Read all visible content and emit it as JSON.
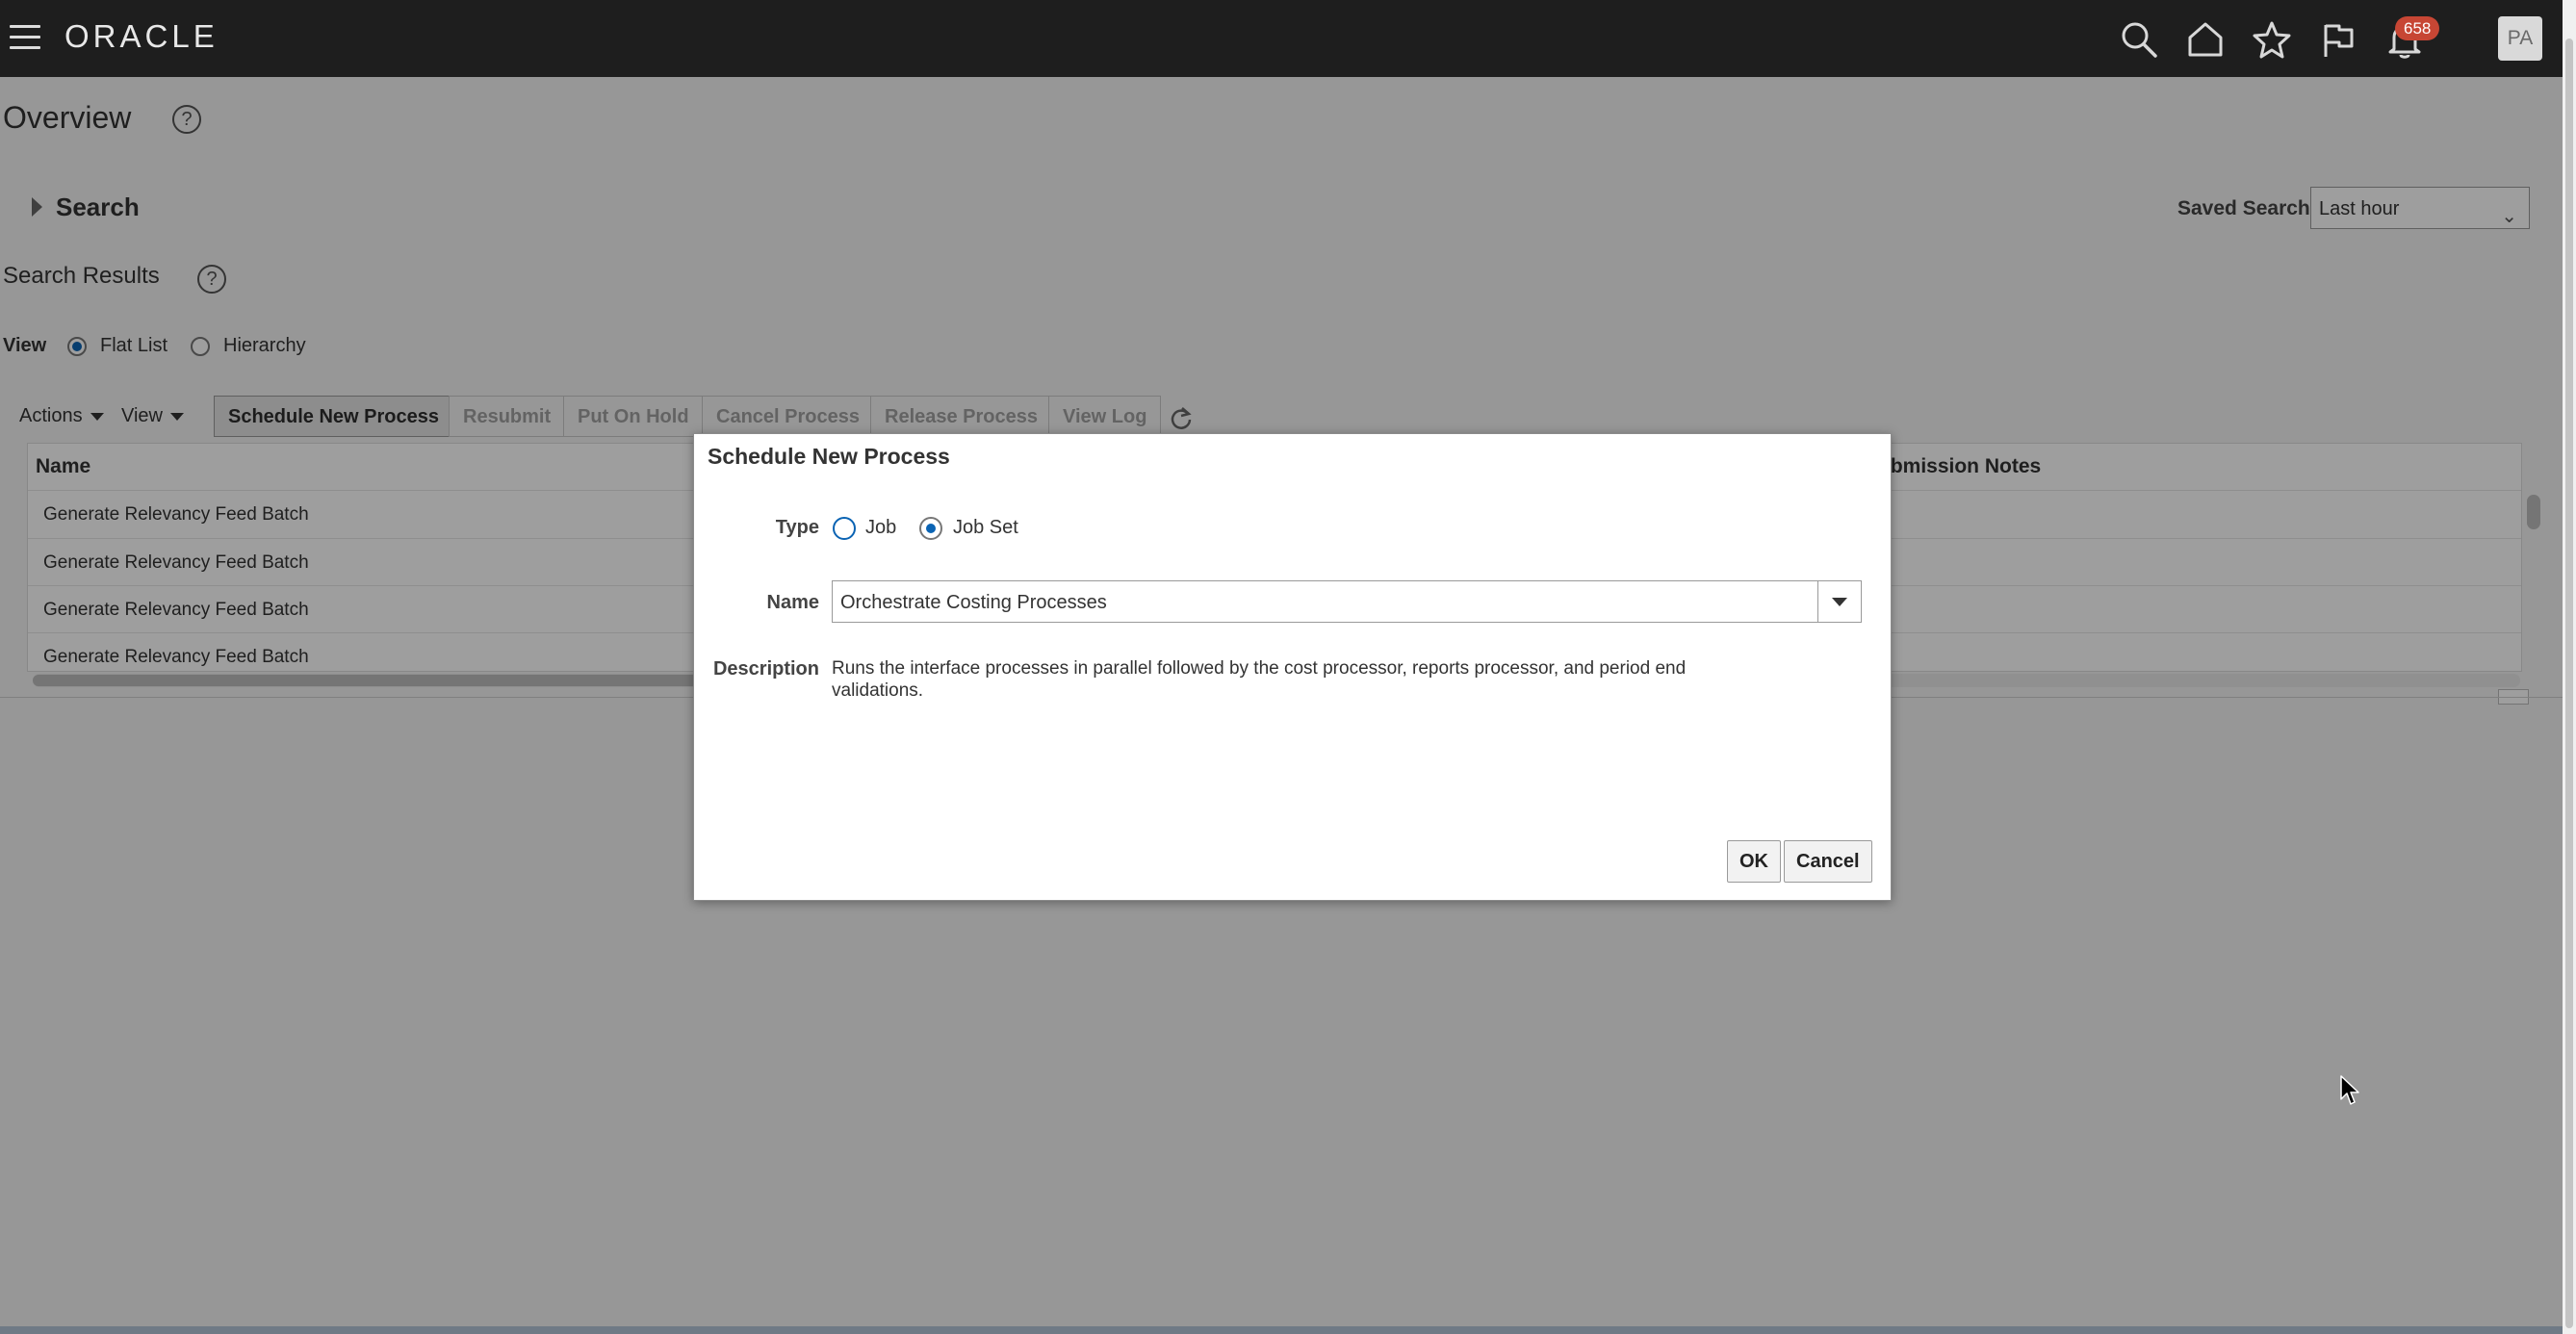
{
  "header": {
    "logo": "ORACLE",
    "notification_count": "658",
    "user_initials": "PA"
  },
  "page": {
    "title": "Overview",
    "search_label": "Search",
    "saved_search_label": "Saved Search",
    "saved_search_value": "Last hour",
    "results_title": "Search Results",
    "view_label": "View",
    "view_options": [
      "Flat List",
      "Hierarchy"
    ]
  },
  "toolbar": {
    "actions": "Actions",
    "view": "View",
    "schedule_new_process": "Schedule New Process",
    "resubmit": "Resubmit",
    "put_on_hold": "Put On Hold",
    "cancel_process": "Cancel Process",
    "release_process": "Release Process",
    "view_log": "View Log"
  },
  "table": {
    "columns": {
      "name": "Name",
      "submission_notes": "ubmission Notes"
    },
    "rows": [
      "Generate Relevancy Feed Batch",
      "Generate Relevancy Feed Batch",
      "Generate Relevancy Feed Batch",
      "Generate Relevancy Feed Batch"
    ]
  },
  "dialog": {
    "title": "Schedule New Process",
    "type_label": "Type",
    "type_options": [
      "Job",
      "Job Set"
    ],
    "name_label": "Name",
    "name_value": "Orchestrate Costing Processes",
    "description_label": "Description",
    "description_text": "Runs the interface processes in parallel followed by the cost processor, reports processor, and period end validations.",
    "ok": "OK",
    "cancel": "Cancel"
  },
  "colors": {
    "topbar": "#1e1e1e",
    "badge": "#c74634",
    "radio_selected": "#0a63b3"
  }
}
